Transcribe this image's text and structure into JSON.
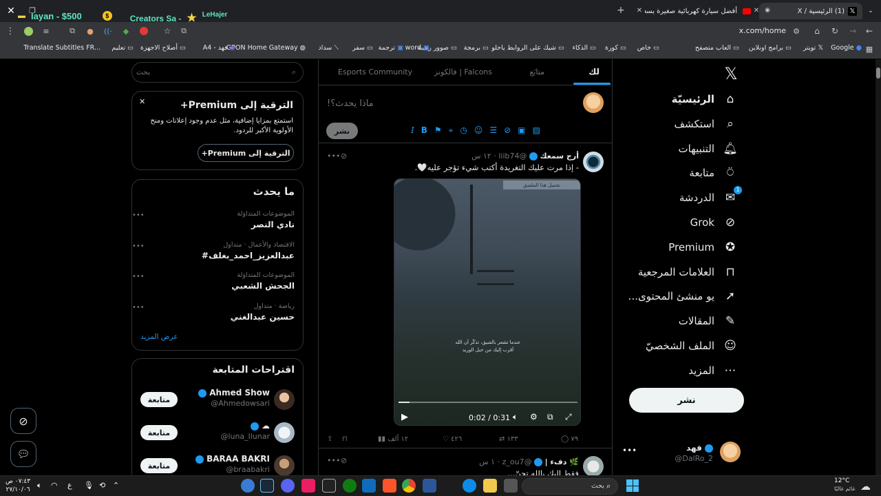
{
  "tabs": {
    "active_title": "(1) الرئيسية / X",
    "other_title": "أفضل سيارة كهربائية صغيرة بسعر مذ...",
    "overlay_left": "layan - $500",
    "overlay_mid": "Creators Sa -",
    "overlay_right": "LeHajer"
  },
  "address": {
    "url": "x.com/home"
  },
  "bookmarks": [
    "Google",
    "تويتر",
    "برامج اونلاين",
    "العاب متصفح",
    "خاص",
    "كورة",
    "الذكاء",
    "شيك على الروابط ياحلو",
    "برمجة",
    "صوور رهيبه",
    "word",
    "ترجمة",
    "سفر",
    "سداد",
    "GPON Home Gateway",
    "فهد - A4",
    "أصلاح الاجهزة",
    "تعليم",
    "Translate Subtitles FR..."
  ],
  "nav": {
    "items": [
      {
        "label": "الرئيسيّة",
        "icon": "home-icon"
      },
      {
        "label": "استكشف",
        "icon": "search-icon"
      },
      {
        "label": "التنبيهات",
        "icon": "bell-icon"
      },
      {
        "label": "متابعة",
        "icon": "add-user-icon"
      },
      {
        "label": "الدردشة",
        "icon": "mail-icon",
        "badge": "1"
      },
      {
        "label": "Grok",
        "icon": "grok-icon"
      },
      {
        "label": "Premium",
        "icon": "premium-icon"
      },
      {
        "label": "العلامات المرجعية",
        "icon": "bookmark-icon"
      },
      {
        "label": "...يو منشئ المحتوى",
        "icon": "rocket-icon"
      },
      {
        "label": "المقالات",
        "icon": "article-icon"
      },
      {
        "label": "الملف الشخصيّ",
        "icon": "profile-icon"
      },
      {
        "label": "المزيد",
        "icon": "more-icon"
      }
    ],
    "post_button": "نشر",
    "account": {
      "name": "فهد",
      "handle": "@DalRo_2"
    }
  },
  "feed": {
    "tabs": [
      "لك",
      "متابَع",
      "فالكونز | Falcons",
      "Esports Community"
    ],
    "composer_placeholder": "ماذا يحدث؟!",
    "composer_post": "نشر",
    "tweet1": {
      "name": "أرج سمعك",
      "handle": "@liib74",
      "time": "١٢ س",
      "text": "- إذا مرت عليك التغريدة أكتب شيء تؤجر عليه🤍.",
      "video_caption_1": "عندما تشعر بالضيق، تذكّر أن الله",
      "video_caption_2": "أقرب إليك من حبل الوريد",
      "video_time": "0:02 / 0:31",
      "video_ad": "تحميل هذا الملصق",
      "progress": 0.06,
      "replies": "٧٩",
      "retweets": "١٣٣",
      "likes": "٤٢٦",
      "views": "١٢ ألف"
    },
    "tweet2": {
      "name": "دفء |",
      "handle": "@z_ou7",
      "time": "١ س",
      "text": "فقط إليك يالله تحنّ..."
    }
  },
  "sidebar": {
    "search_placeholder": "بحث",
    "premium": {
      "title": "الترقية إلى Premium+",
      "body": "استمتع بمزايا إضافية، مثل عدم وجود إعلانات ومنح الأولوية الأكبر للردود.",
      "button": "الترقية إلى Premium+"
    },
    "trends_title": "ما يحدث",
    "trends": [
      {
        "meta": "الموضوعات المتداوَلة",
        "name": "نادي النصر"
      },
      {
        "meta": "الاقتصاد والأعمال · متداول",
        "name": "#عبدالعزيز_احمد_بغلف"
      },
      {
        "meta": "الموضوعات المتداوَلة",
        "name": "الجحش الشعبي"
      },
      {
        "meta": "رياضة · متداول",
        "name": "حسين عبدالغني"
      }
    ],
    "show_more": "عرض المزيد",
    "suggestions_title": "اقتراحات المتابعة",
    "suggestions": [
      {
        "name": "Ahmed Show",
        "handle": "@Ahmedowsari",
        "button": "متابعة"
      },
      {
        "name": "☁",
        "handle": "@luna_llunar",
        "button": "متابعة"
      },
      {
        "name": "BARAA BAKRI",
        "handle": "@braabakri",
        "button": "متابعة"
      }
    ]
  },
  "taskbar": {
    "search_placeholder": "بحث",
    "weather_temp": "12°C",
    "weather_text": "غائم غالبًا",
    "time": "٠٧:٤٣ ص",
    "date": "٢٧/١٠/٠٦",
    "lang": "ع"
  }
}
